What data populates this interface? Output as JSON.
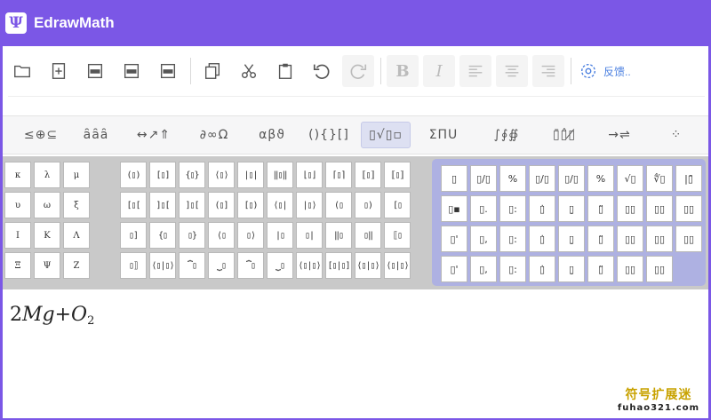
{
  "app": {
    "title": "EdrawMath",
    "logo_glyph": "Ψ",
    "accent": "#7b57e6"
  },
  "toolbar": {
    "items": [
      {
        "name": "open-icon",
        "glyph": "🗀"
      },
      {
        "name": "new-icon",
        "glyph": "+"
      },
      {
        "name": "export-pdf-icon",
        "glyph": "PDF"
      },
      {
        "name": "export-html-icon",
        "glyph": "htm"
      },
      {
        "name": "export-tex-icon",
        "glyph": "TEX"
      },
      {
        "name": "copy-icon",
        "glyph": "⧉"
      },
      {
        "name": "cut-icon",
        "glyph": "✂"
      },
      {
        "name": "paste-icon",
        "glyph": "📋"
      },
      {
        "name": "undo-icon",
        "glyph": "↺"
      },
      {
        "name": "redo-icon",
        "glyph": "↻"
      }
    ],
    "bold": "B",
    "italic": "I",
    "feedback_label": "反馈.."
  },
  "palette_tabs": [
    {
      "name": "tab-relations",
      "label": "≤⊕⊆"
    },
    {
      "name": "tab-accents",
      "label": "ȃȃȃ"
    },
    {
      "name": "tab-arrows",
      "label": "↔↗⇑"
    },
    {
      "name": "tab-calculus",
      "label": "∂∞Ω"
    },
    {
      "name": "tab-greek",
      "label": "αβϑ"
    },
    {
      "name": "tab-fences",
      "label": "(){}[]"
    },
    {
      "name": "tab-fractions",
      "label": "▯√▯▫"
    },
    {
      "name": "tab-operators",
      "label": "ΣΠU"
    },
    {
      "name": "tab-integrals",
      "label": "∫∮∯"
    },
    {
      "name": "tab-decorations",
      "label": "▯̄▯̂▯̸"
    },
    {
      "name": "tab-labeled-arrows",
      "label": "→⇌"
    },
    {
      "name": "tab-matrix",
      "label": "⁘"
    }
  ],
  "greek_symbols": [
    "κ",
    "λ",
    "μ",
    "υ",
    "ω",
    "ξ",
    "Ι",
    "Κ",
    "Λ",
    "Ξ",
    "Ψ",
    "Ζ"
  ],
  "fence_symbols": [
    "(▯)",
    "[▯]",
    "{▯}",
    "⟨▯⟩",
    "|▯|",
    "‖▯‖",
    "⌊▯⌋",
    "⌈▯⌉",
    "⟦▯⟧",
    "⟦▯⟧",
    "[▯[",
    "]▯[",
    "]▯[",
    "(▯]",
    "[▯)",
    "⟨▯|",
    "|▯⟩",
    "(▯",
    "▯)",
    "[▯",
    "▯]",
    "{▯",
    "▯}",
    "⟨▯",
    "▯⟩",
    "|▯",
    "▯|",
    "‖▯",
    "▯‖",
    "⟦▯",
    "▯⟧",
    "⟨▯|▯⟩",
    "⏞▯",
    "⏟▯",
    "⏞▯",
    "⏟▯",
    "⟨▯|▯⟩",
    "[▯|▯]",
    "⟨▯|▯⟩",
    "⟨▯|▯⟩"
  ],
  "fraction_symbols": [
    "▯",
    "▯/▯",
    "%",
    "▯/▯",
    "▯/▯",
    "%",
    "√▯",
    "∜▯",
    "|▯̄",
    "▯▪",
    "▯.",
    "▯:",
    "▯̇",
    "▯̣",
    "▯̈",
    "▯▯",
    "▯▯",
    "▯▯",
    "▯'",
    "▯,",
    "▯:",
    "▯̇",
    "▯̣",
    "▯̈",
    "▯▯",
    "▯▯",
    "▯▯",
    "▯'",
    "▯,",
    "▯:",
    "▯̇",
    "▯̣",
    "▯̈",
    "▯▯",
    "▯▯"
  ],
  "formula": {
    "coef": "2",
    "var1": "Mg",
    "op": "+",
    "var2": "O",
    "sub": "2"
  },
  "watermark": {
    "line1": "符号扩展迷",
    "line2": "fuhao321.com"
  }
}
